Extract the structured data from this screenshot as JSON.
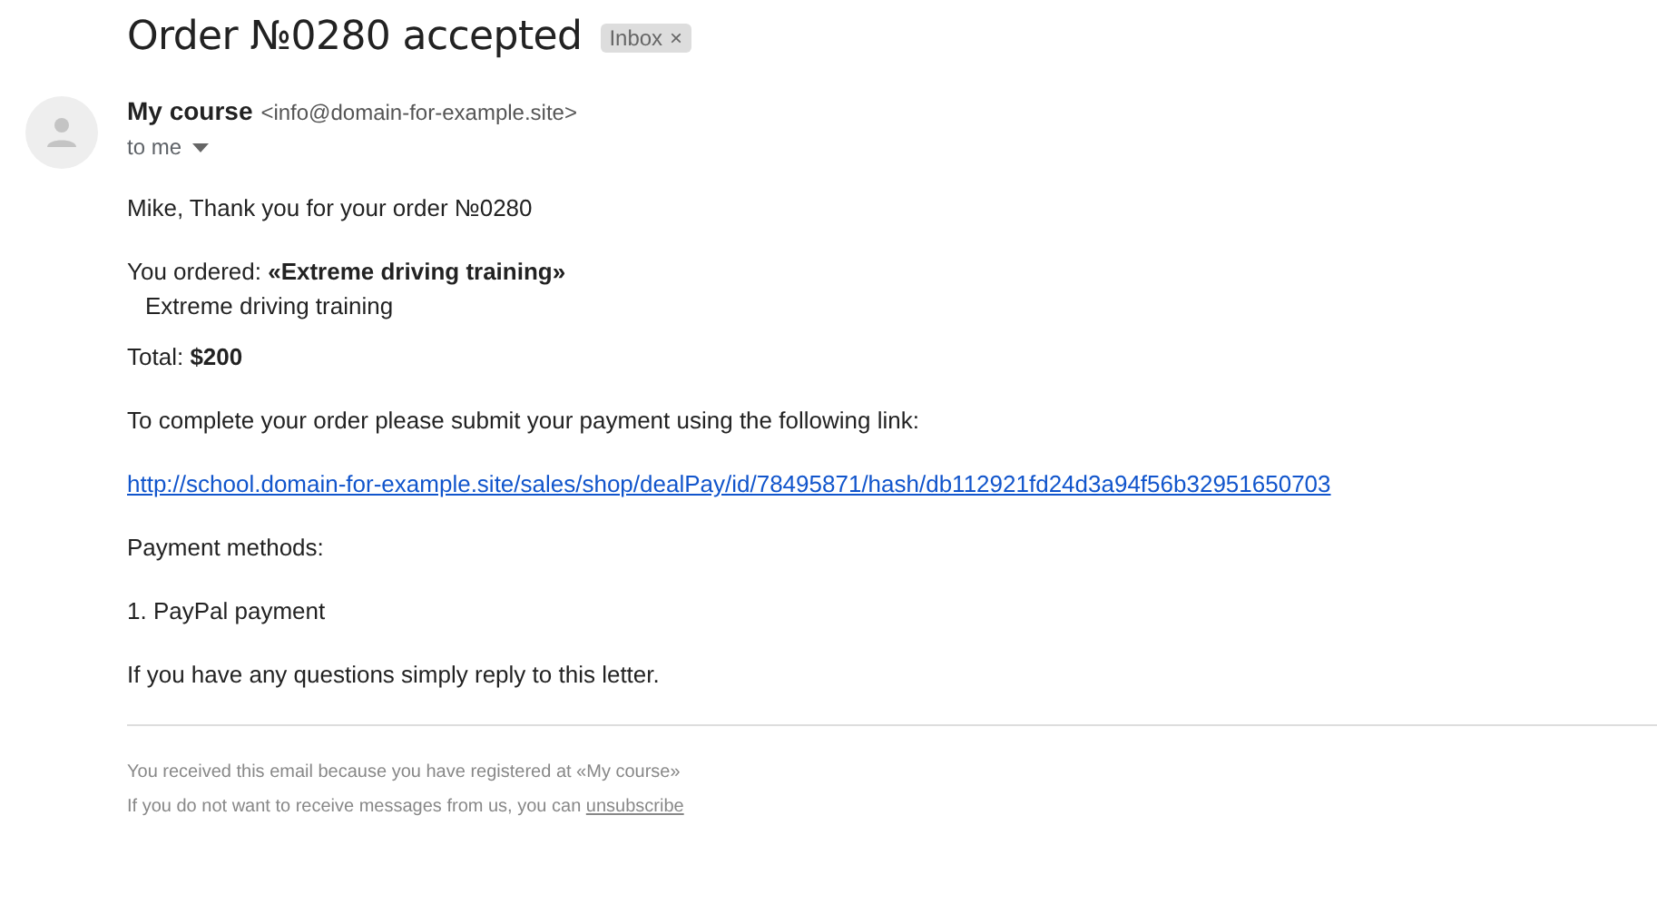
{
  "subject": "Order №0280 accepted",
  "label": {
    "text": "Inbox",
    "remove": "×"
  },
  "sender": {
    "name": "My course",
    "email": "<info@domain-for-example.site>",
    "recipient": "to me"
  },
  "body": [
    {
      "kind": "paragraph",
      "text": "Mike, Thank you for your order №0280"
    },
    {
      "kind": "heading",
      "text": "You ordered: **«Extreme driving training»**"
    },
    {
      "kind": "item",
      "text": "Extreme driving training"
    },
    {
      "kind": "total",
      "text": "Total: **$200**"
    },
    {
      "kind": "paragraph",
      "text": "To complete your order please submit your payment using the following link:"
    },
    {
      "kind": "link",
      "text": "http://school.domain-for-example.site/sales/shop/dealPay/id/78495871/hash/db112921fd24d3a94f56b32951650703"
    },
    {
      "kind": "paragraph",
      "text": "Payment methods:"
    },
    {
      "kind": "paragraph",
      "text": "1. PayPal payment"
    },
    {
      "kind": "paragraph",
      "text": "If you have any questions simply reply to this letter."
    }
  ],
  "footer": {
    "notice": "You received this email because you have registered at «My course»",
    "unsubscribe_text": "If you do not want to receive messages from us, you can",
    "unsubscribe_link": "unsubscribe"
  }
}
